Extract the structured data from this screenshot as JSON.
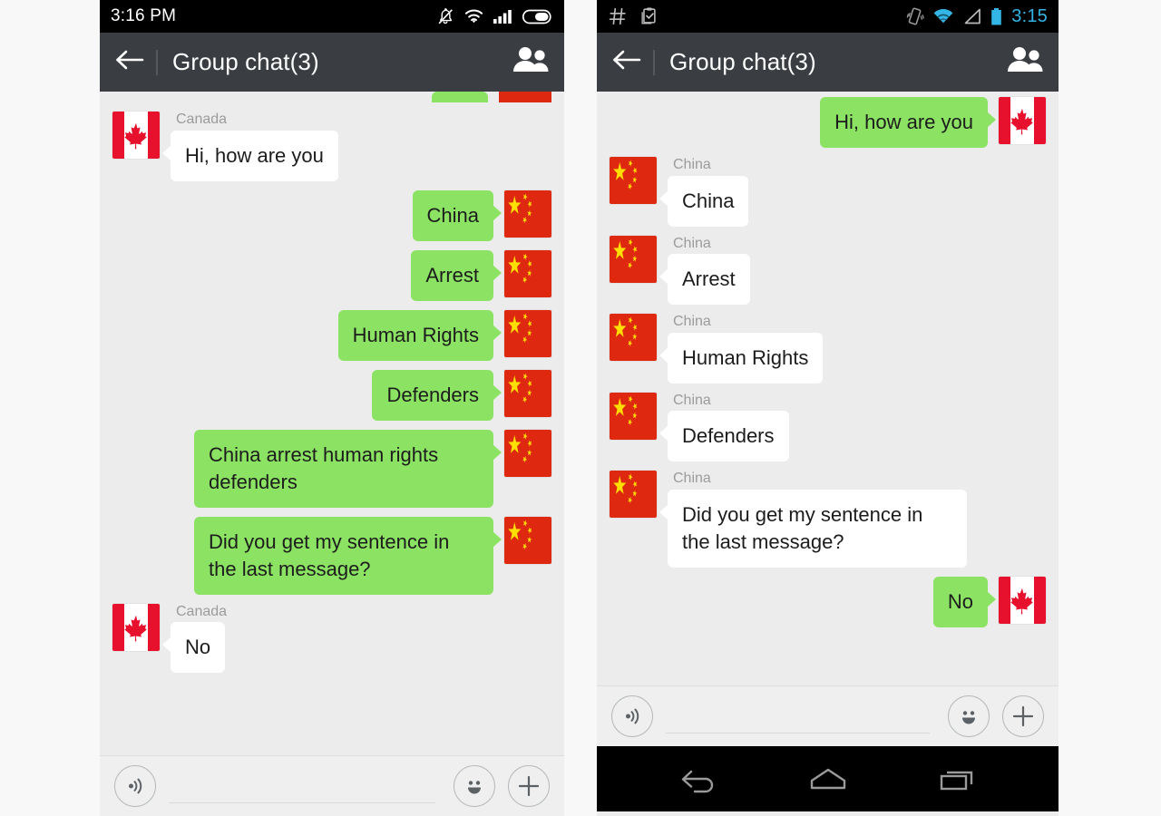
{
  "meta": {
    "accent_green": "#8ce363",
    "bubble_in": "#ffffff",
    "appbar_color": "#3a3d42",
    "chat_bg": "#ececec",
    "flag_china_red": "#de2910",
    "flag_china_yellow": "#ffde00",
    "flag_canada_red": "#e8112d",
    "status_blue": "#33b5e5"
  },
  "phone_left": {
    "status": {
      "time": "3:16 PM",
      "icons": [
        "bell-muted-icon",
        "wifi-icon",
        "signal-bars-icon",
        "battery-icon"
      ]
    },
    "appbar": {
      "back_label": "←",
      "title": "Group chat(3)",
      "members_icon": "group-members-icon"
    },
    "partial_top_message": {
      "side": "right",
      "flag": "china"
    },
    "messages": [
      {
        "side": "left",
        "sender": "Canada",
        "text": "Hi, how are you",
        "flag": "canada"
      },
      {
        "side": "right",
        "sender": "",
        "text": "China",
        "flag": "china"
      },
      {
        "side": "right",
        "sender": "",
        "text": "Arrest",
        "flag": "china"
      },
      {
        "side": "right",
        "sender": "",
        "text": "Human Rights",
        "flag": "china"
      },
      {
        "side": "right",
        "sender": "",
        "text": "Defenders",
        "flag": "china"
      },
      {
        "side": "right",
        "sender": "",
        "text": "China arrest human rights defenders",
        "flag": "china"
      },
      {
        "side": "right",
        "sender": "",
        "text": "Did you get my sentence in the last message?",
        "flag": "china"
      },
      {
        "side": "left",
        "sender": "Canada",
        "text": "No",
        "flag": "canada"
      }
    ],
    "composer": {
      "voice_icon": "voice-record-icon",
      "input_value": "",
      "input_placeholder": "",
      "emoji_icon": "emoji-icon",
      "plus_icon": "plus-icon"
    }
  },
  "phone_right": {
    "status": {
      "time": "3:15",
      "left_icons": [
        "hash-icon",
        "clipboard-check-icon"
      ],
      "right_icons": [
        "vibrate-icon",
        "wifi-icon",
        "signal-triangle-icon",
        "battery-icon"
      ]
    },
    "appbar": {
      "back_label": "←",
      "title": "Group chat(3)",
      "members_icon": "group-members-icon"
    },
    "messages": [
      {
        "side": "right",
        "sender": "",
        "text": "Hi, how are you",
        "flag": "canada"
      },
      {
        "side": "left",
        "sender": "China",
        "text": "China",
        "flag": "china"
      },
      {
        "side": "left",
        "sender": "China",
        "text": "Arrest",
        "flag": "china"
      },
      {
        "side": "left",
        "sender": "China",
        "text": "Human Rights",
        "flag": "china"
      },
      {
        "side": "left",
        "sender": "China",
        "text": "Defenders",
        "flag": "china"
      },
      {
        "side": "left",
        "sender": "China",
        "text": "Did you get my sentence in the last message?",
        "flag": "china"
      },
      {
        "side": "right",
        "sender": "",
        "text": "No",
        "flag": "canada"
      }
    ],
    "composer": {
      "voice_icon": "voice-record-icon",
      "input_value": "",
      "input_placeholder": "",
      "emoji_icon": "emoji-icon",
      "plus_icon": "plus-icon"
    },
    "navbar": {
      "back_icon": "android-back-icon",
      "home_icon": "android-home-icon",
      "recents_icon": "android-recents-icon"
    }
  }
}
